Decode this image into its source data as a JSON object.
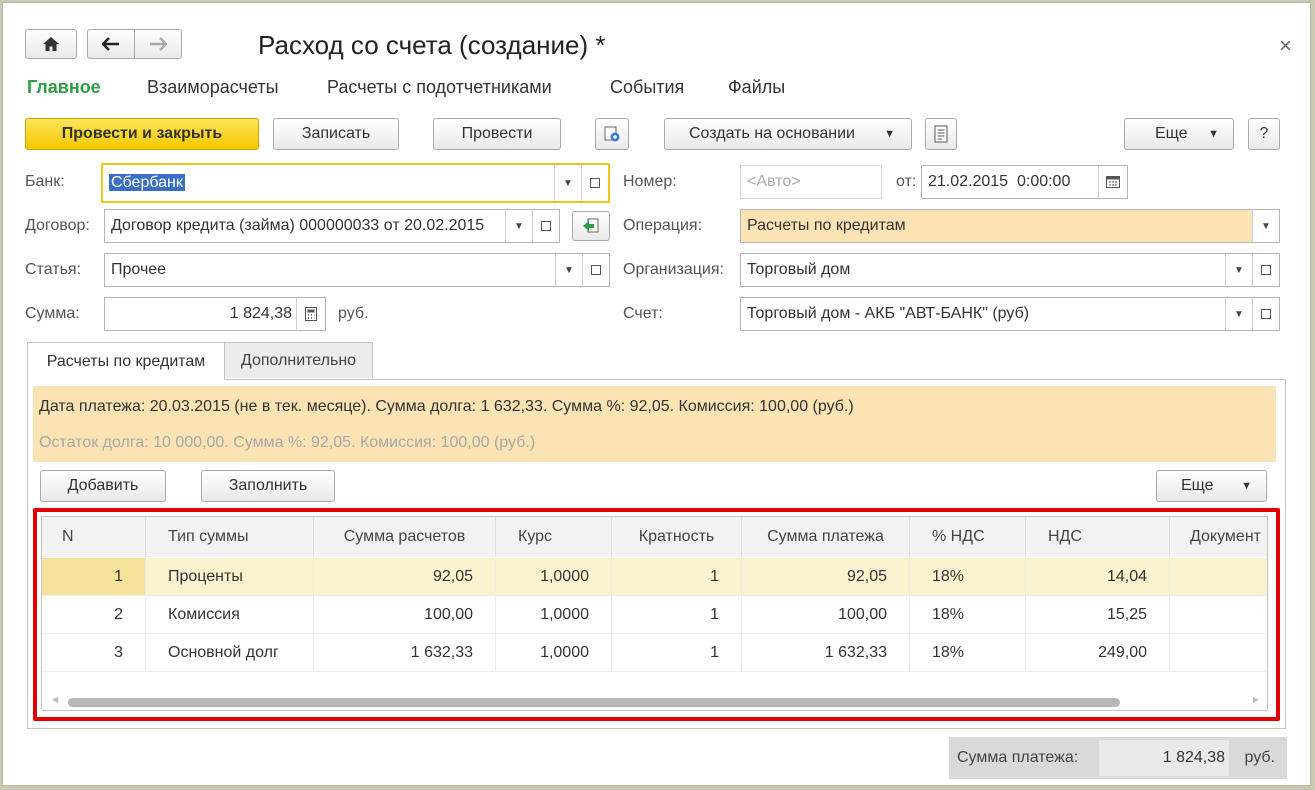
{
  "window": {
    "title": "Расход со счета (создание) *",
    "close_glyph": "×"
  },
  "nav": {
    "home_icon": "home-icon",
    "back_icon": "arrow-left-icon",
    "forward_icon": "arrow-right-icon"
  },
  "menu": {
    "items": [
      "Главное",
      "Взаиморасчеты",
      "Расчеты с подотчетниками",
      "События",
      "Файлы"
    ],
    "active_color": "#2e9e47"
  },
  "toolbar": {
    "post_close": "Провести и закрыть",
    "save": "Записать",
    "post": "Провести",
    "create_based": "Создать на основании",
    "more": "Еще",
    "help": "?"
  },
  "form": {
    "bank_label": "Банк:",
    "bank_value": "Сбербанк",
    "contract_label": "Договор:",
    "contract_value": "Договор кредита (займа) 000000033 от 20.02.2015",
    "article_label": "Статья:",
    "article_value": "Прочее",
    "sum_label": "Сумма:",
    "sum_value": "1 824,38",
    "sum_currency": "руб.",
    "number_label": "Номер:",
    "number_placeholder": "<Авто>",
    "date_label": "от:",
    "date_value": "21.02.2015  0:00:00",
    "operation_label": "Операция:",
    "operation_value": "Расчеты по кредитам",
    "org_label": "Организация:",
    "org_value": "Торговый дом",
    "account_label": "Счет:",
    "account_value": "Торговый дом - АКБ \"АВТ-БАНК\" (руб)"
  },
  "tabs": [
    "Расчеты по кредитам",
    "Дополнительно"
  ],
  "info": {
    "line1": "Дата платежа: 20.03.2015 (не в тек. месяце). Сумма долга: 1 632,33. Сумма %: 92,05. Комиссия: 100,00 (руб.)",
    "line2": "Остаток долга: 10 000,00. Сумма %: 92,05. Комиссия: 100,00 (руб.)"
  },
  "table_toolbar": {
    "add": "Добавить",
    "fill": "Заполнить",
    "more": "Еще"
  },
  "table": {
    "columns": [
      "N",
      "Тип суммы",
      "Сумма расчетов",
      "Курс",
      "Кратность",
      "Сумма платежа",
      "% НДС",
      "НДС",
      "Документ"
    ],
    "rows": [
      [
        "1",
        "Проценты",
        "92,05",
        "1,0000",
        "1",
        "92,05",
        "18%",
        "14,04",
        ""
      ],
      [
        "2",
        "Комиссия",
        "100,00",
        "1,0000",
        "1",
        "100,00",
        "18%",
        "15,25",
        ""
      ],
      [
        "3",
        "Основной долг",
        "1 632,33",
        "1,0000",
        "1",
        "1 632,33",
        "18%",
        "249,00",
        ""
      ]
    ]
  },
  "footer": {
    "label": "Сумма платежа:",
    "value": "1 824,38",
    "currency": "руб."
  },
  "colors": {
    "highlight_row": "#fbf3d0",
    "info_bg": "#fbe3b4",
    "operation_bg": "#fbe3b4",
    "red_border": "#e00000"
  }
}
